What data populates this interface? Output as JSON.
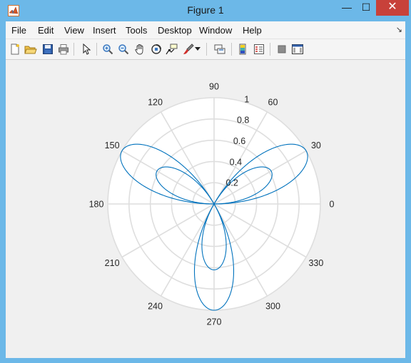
{
  "window": {
    "title": "Figure 1",
    "minimize_glyph": "—",
    "maximize_glyph": "☐",
    "close_glyph": "✕"
  },
  "menubar": {
    "items": [
      "File",
      "Edit",
      "View",
      "Insert",
      "Tools",
      "Desktop",
      "Window",
      "Help"
    ],
    "overflow_glyph": "↘"
  },
  "toolbar": {
    "buttons": [
      {
        "icon": "new-figure-icon"
      },
      {
        "icon": "open-file-icon"
      },
      {
        "icon": "save-icon"
      },
      {
        "icon": "print-icon"
      },
      {
        "icon": "edit-plot-arrow-icon"
      },
      {
        "icon": "zoom-in-icon"
      },
      {
        "icon": "zoom-out-icon"
      },
      {
        "icon": "pan-hand-icon"
      },
      {
        "icon": "rotate-3d-icon"
      },
      {
        "icon": "data-cursor-icon"
      },
      {
        "icon": "brush-icon"
      },
      {
        "icon": "brush-dropdown-icon"
      },
      {
        "icon": "link-plot-icon"
      },
      {
        "icon": "insert-colorbar-icon"
      },
      {
        "icon": "insert-legend-icon"
      },
      {
        "icon": "hide-plot-tools-icon"
      },
      {
        "icon": "show-plot-tools-icon"
      }
    ]
  },
  "colors": {
    "title_bar": "#6cb8e8",
    "close_button": "#c8413a",
    "figure_background": "#f0f0f0",
    "polar_face": "#ffffff",
    "grid": "#dedede",
    "curve": "#0072bd",
    "text": "#262626"
  },
  "chart_data": {
    "type": "polar-line",
    "title": "",
    "function": "r = sin(3*theta)",
    "theta_range_degrees": [
      0,
      360
    ],
    "rlim": [
      0,
      1
    ],
    "theta_ticks": [
      "0",
      "30",
      "60",
      "90",
      "120",
      "150",
      "180",
      "210",
      "240",
      "270",
      "300",
      "330"
    ],
    "r_ticks": [
      "0.2",
      "0.4",
      "0.6",
      "0.8",
      "1"
    ],
    "r_tick_values": [
      0.2,
      0.4,
      0.6,
      0.8,
      1.0
    ],
    "r_tick_label_angle_degrees": 80,
    "grid": true,
    "series": [
      {
        "lobes": [
          {
            "direction_degrees": 30,
            "peak_r": 1.0
          },
          {
            "direction_degrees": 150,
            "peak_r": 1.0
          },
          {
            "direction_degrees": 270,
            "peak_r": 1.0
          }
        ]
      }
    ]
  }
}
